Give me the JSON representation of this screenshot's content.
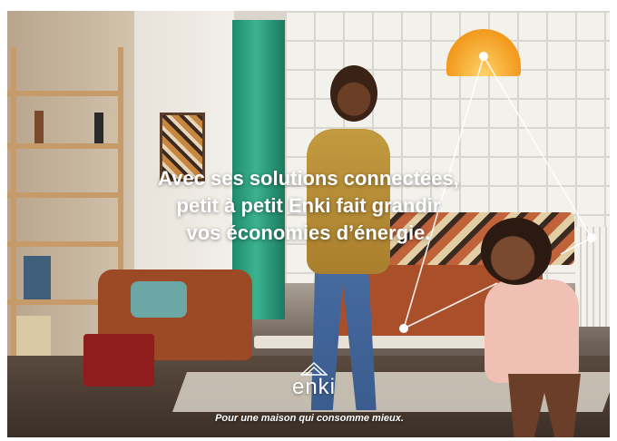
{
  "ad": {
    "headline_lines": [
      "Avec ses solutions connectées,",
      "petit à petit Enki fait grandir",
      "vos économies d’énergie."
    ],
    "brand_name": "enki",
    "tagline": "Pour une maison qui consomme mieux."
  },
  "colors": {
    "text": "#ffffff",
    "curtain": "#1f8a6d",
    "lamp": "#f29a1e",
    "sofa": "#a9502a"
  },
  "icons": {
    "brand_mark": "enki-house-logo-icon"
  }
}
